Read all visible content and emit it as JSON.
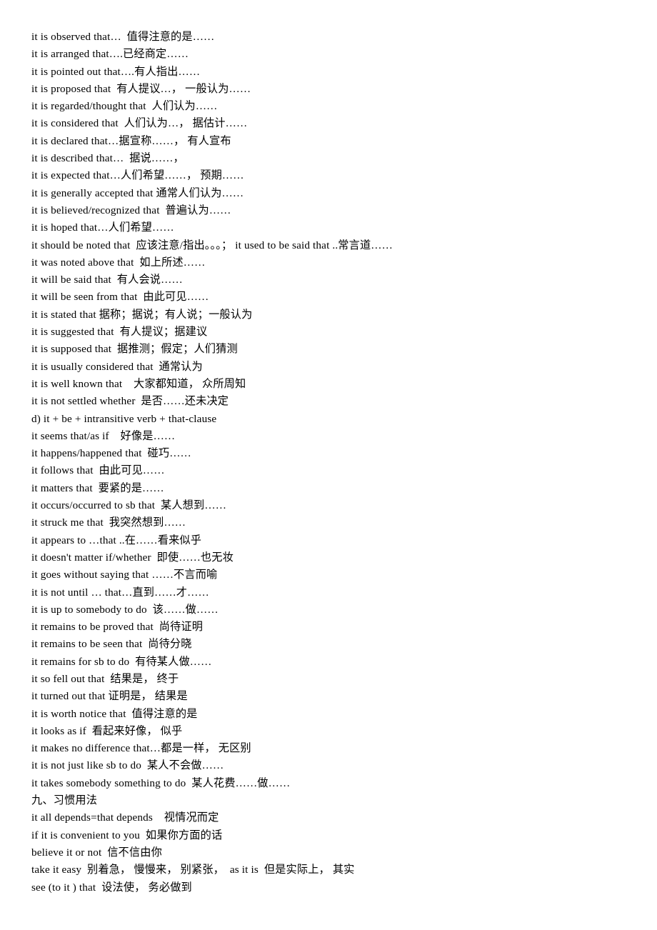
{
  "document": {
    "page_background": "#ffffff",
    "text_color": "#000000",
    "lines": [
      {
        "id": "line-1",
        "text": "it is observed that…  值得注意的是……"
      },
      {
        "id": "line-2",
        "text": "it is arranged that….已经商定……"
      },
      {
        "id": "line-3",
        "text": "it is pointed out that….有人指出……"
      },
      {
        "id": "line-4",
        "text": "it is proposed that  有人提议…， 一般认为……"
      },
      {
        "id": "line-5",
        "text": "it is regarded/thought that  人们认为……"
      },
      {
        "id": "line-6",
        "text": "it is considered that  人们认为…， 据估计……"
      },
      {
        "id": "line-7",
        "text": "it is declared that…据宣称……， 有人宣布"
      },
      {
        "id": "line-8",
        "text": "it is described that…  据说……，"
      },
      {
        "id": "line-9",
        "text": "it is expected that…人们希望……， 预期……"
      },
      {
        "id": "line-10",
        "text": "it is generally accepted that 通常人们认为……"
      },
      {
        "id": "line-11",
        "text": "it is believed/recognized that  普遍认为……"
      },
      {
        "id": "line-12",
        "text": "it is hoped that…人们希望……"
      },
      {
        "id": "line-13",
        "text": "it should be noted that  应该注意/指出。。。； it used to be said that ..常言道……"
      },
      {
        "id": "line-14",
        "text": "it was noted above that  如上所述……"
      },
      {
        "id": "line-15",
        "text": "it will be said that  有人会说……"
      },
      {
        "id": "line-16",
        "text": "it will be seen from that  由此可见……"
      },
      {
        "id": "line-17",
        "text": "it is stated that 据称；据说；有人说；一般认为"
      },
      {
        "id": "line-18",
        "text": "it is suggested that  有人提议；据建议"
      },
      {
        "id": "line-19",
        "text": "it is supposed that  据推测；假定；人们猜测"
      },
      {
        "id": "line-20",
        "text": "it is usually considered that  通常认为"
      },
      {
        "id": "line-21",
        "text": "it is well known that    大家都知道， 众所周知"
      },
      {
        "id": "line-22",
        "text": "it is not settled whether  是否……还未决定"
      },
      {
        "id": "line-23",
        "text": "d) it + be + intransitive verb + that-clause"
      },
      {
        "id": "line-24",
        "text": "it seems that/as if    好像是……"
      },
      {
        "id": "line-25",
        "text": "it happens/happened that  碰巧……"
      },
      {
        "id": "line-26",
        "text": "it follows that  由此可见……"
      },
      {
        "id": "line-27",
        "text": "it matters that  要紧的是……"
      },
      {
        "id": "line-28",
        "text": "it occurs/occurred to sb that  某人想到……"
      },
      {
        "id": "line-29",
        "text": "it struck me that  我突然想到……"
      },
      {
        "id": "line-30",
        "text": "it appears to …that ..在……看来似乎"
      },
      {
        "id": "line-31",
        "text": "it doesn't matter if/whether  即使……也无妆"
      },
      {
        "id": "line-32",
        "text": "it goes without saying that ……不言而喻"
      },
      {
        "id": "line-33",
        "text": "it is not until … that…直到……才……"
      },
      {
        "id": "line-34",
        "text": "it is up to somebody to do  该……做……"
      },
      {
        "id": "line-35",
        "text": "it remains to be proved that  尚待证明"
      },
      {
        "id": "line-36",
        "text": "it remains to be seen that  尚待分晓"
      },
      {
        "id": "line-37",
        "text": "it remains for sb to do  有待某人做……"
      },
      {
        "id": "line-38",
        "text": "it so fell out that  结果是， 终于"
      },
      {
        "id": "line-39",
        "text": "it turned out that 证明是， 结果是"
      },
      {
        "id": "line-40",
        "text": "it is worth notice that  值得注意的是"
      },
      {
        "id": "line-41",
        "text": "it looks as if  看起来好像， 似乎"
      },
      {
        "id": "line-42",
        "text": "it makes no difference that…都是一样， 无区别"
      },
      {
        "id": "line-43",
        "text": "it is not just like sb to do  某人不会做……"
      },
      {
        "id": "line-44",
        "text": "it takes somebody something to do  某人花费……做……"
      },
      {
        "id": "line-45",
        "text": "九、习惯用法",
        "heading": true
      },
      {
        "id": "line-46",
        "text": "it all depends=that depends    视情况而定"
      },
      {
        "id": "line-47",
        "text": "if it is convenient to you  如果你方面的话"
      },
      {
        "id": "line-48",
        "text": "believe it or not  信不信由你"
      },
      {
        "id": "line-49",
        "text": "take it easy  别着急， 慢慢来， 别紧张，  as it is  但是实际上， 其实"
      },
      {
        "id": "line-50",
        "text": "see (to it ) that  设法使， 务必做到"
      }
    ]
  }
}
